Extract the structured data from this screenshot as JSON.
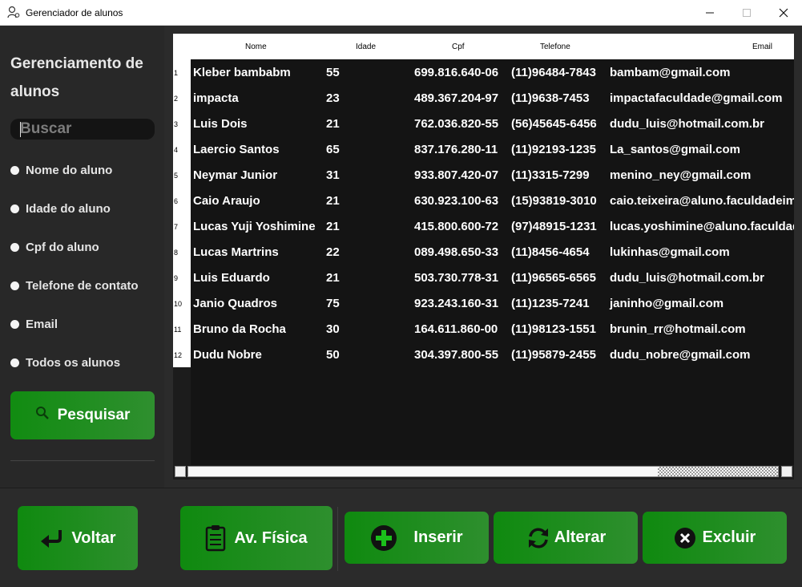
{
  "window": {
    "title": "Gerenciador de alunos"
  },
  "sidebar": {
    "heading": "Gerenciamento de alunos",
    "search_placeholder": "Buscar",
    "filters": [
      "Nome do aluno",
      "Idade do aluno",
      "Cpf do aluno",
      "Telefone de contato",
      "Email",
      "Todos os alunos"
    ],
    "search_button": "Pesquisar"
  },
  "table": {
    "headers": [
      "Nome",
      "Idade",
      "Cpf",
      "Telefone",
      "Email"
    ],
    "rows": [
      [
        "1",
        "Kleber bambabm",
        "55",
        "699.816.640-06",
        "(11)96484-7843",
        "bambam@gmail.com"
      ],
      [
        "2",
        "impacta",
        "23",
        "489.367.204-97",
        "(11)9638-7453",
        "impactafaculdade@gmail.com"
      ],
      [
        "3",
        "Luis Dois",
        "21",
        "762.036.820-55",
        "(56)45645-6456",
        "dudu_luis@hotmail.com.br"
      ],
      [
        "4",
        "Laercio Santos",
        "65",
        "837.176.280-11",
        "(11)92193-1235",
        "La_santos@gmail.com"
      ],
      [
        "5",
        "Neymar Junior",
        "31",
        "933.807.420-07",
        "(11)3315-7299",
        "menino_ney@gmail.com"
      ],
      [
        "6",
        "Caio Araujo",
        "21",
        "630.923.100-63",
        "(15)93819-3010",
        "caio.teixeira@aluno.faculdadeimpacta"
      ],
      [
        "7",
        "Lucas Yuji Yoshimine",
        "21",
        "415.800.600-72",
        "(97)48915-1231",
        "lucas.yoshimine@aluno.faculdadeimpacta"
      ],
      [
        "8",
        "Lucas Martrins",
        "22",
        "089.498.650-33",
        "(11)8456-4654",
        "lukinhas@gmail.com"
      ],
      [
        "9",
        "Luis Eduardo",
        "21",
        "503.730.778-31",
        "(11)96565-6565",
        "dudu_luis@hotmail.com.br"
      ],
      [
        "10",
        "Janio Quadros",
        "75",
        "923.243.160-31",
        "(11)1235-7241",
        "janinho@gmail.com"
      ],
      [
        "11",
        "Bruno da Rocha",
        "30",
        "164.611.860-00",
        "(11)98123-1551",
        "brunin_rr@hotmail.com"
      ],
      [
        "12",
        "Dudu Nobre",
        "50",
        "304.397.800-55",
        "(11)95879-2455",
        "dudu_nobre@gmail.com"
      ]
    ]
  },
  "actions": {
    "voltar": "Voltar",
    "avfisica": "Av. Física",
    "inserir": "Inserir",
    "alterar": "Alterar",
    "excluir": "Excluir"
  },
  "colors": {
    "accent_green": "#118c11",
    "background": "#2b2b2b",
    "table_bg": "#141414"
  }
}
